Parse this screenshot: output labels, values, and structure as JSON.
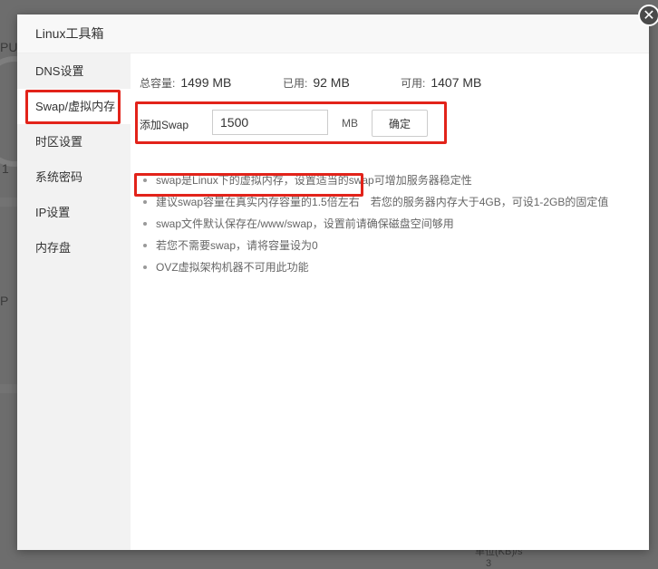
{
  "background": {
    "cpu_fragment": "PU",
    "p_fragment": "P",
    "num_fragment": "1",
    "bottom_fragment": "单位(KB)/s",
    "bottom_num": "3"
  },
  "dialog": {
    "title": "Linux工具箱",
    "close_icon": "close-icon"
  },
  "sidebar": {
    "items": [
      {
        "label": "DNS设置",
        "active": false
      },
      {
        "label": "Swap/虚拟内存",
        "active": true
      },
      {
        "label": "时区设置",
        "active": false
      },
      {
        "label": "系统密码",
        "active": false
      },
      {
        "label": "IP设置",
        "active": false
      },
      {
        "label": "内存盘",
        "active": false
      }
    ]
  },
  "stats": {
    "total_label": "总容量:",
    "total_value": "1499 MB",
    "used_label": "已用:",
    "used_value": "92 MB",
    "free_label": "可用:",
    "free_value": "1407 MB"
  },
  "swap": {
    "label": "添加Swap",
    "value": "1500",
    "unit": "MB",
    "confirm_label": "确定"
  },
  "tips": {
    "t1": "swap是Linux下的虚拟内存，设置适当的swap可增加服务器稳定性",
    "t2": "建议swap容量在真实内存容量的1.5倍左右",
    "t2_extra": "若您的服务器内存大于4GB，可设1-2GB的固定值",
    "t3": "swap文件默认保存在/www/swap，设置前请确保磁盘空间够用",
    "t4": "若您不需要swap，请将容量设为0",
    "t5": "OVZ虚拟架构机器不可用此功能"
  },
  "colors": {
    "highlight": "#e2231a",
    "overlay": "#6f6f6f"
  }
}
